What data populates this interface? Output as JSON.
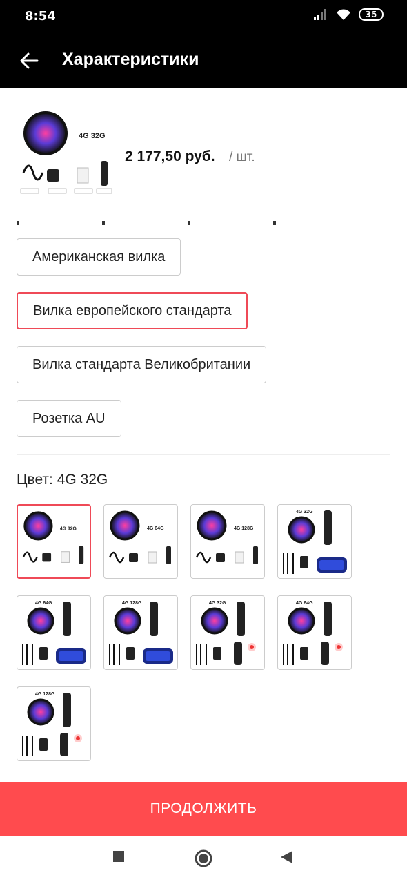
{
  "status": {
    "time": "8:54",
    "battery": "35"
  },
  "header": {
    "title": "Характеристики"
  },
  "product": {
    "price": "2 177,50 руб.",
    "unit": "/ шт.",
    "thumb_text": "4G  32G"
  },
  "plug_options": [
    {
      "label": "Американская вилка",
      "selected": false
    },
    {
      "label": "Вилка европейского стандарта",
      "selected": true
    },
    {
      "label": "Вилка стандарта Великобритании",
      "selected": false
    },
    {
      "label": "Розетка AU",
      "selected": false
    }
  ],
  "color": {
    "label": "Цвет: 4G 32G",
    "variants": [
      {
        "text": "4G  32G",
        "kind": "box",
        "selected": true
      },
      {
        "text": "4G  64G",
        "kind": "box",
        "selected": false
      },
      {
        "text": "4G  128G",
        "kind": "box",
        "selected": false
      },
      {
        "text": "4G 32G",
        "kind": "keyboard",
        "selected": false
      },
      {
        "text": "4G 64G",
        "kind": "keyboard",
        "selected": false
      },
      {
        "text": "4G 128G",
        "kind": "keyboard",
        "selected": false
      },
      {
        "text": "4G 32G",
        "kind": "airmouse",
        "selected": false
      },
      {
        "text": "4G 64G",
        "kind": "airmouse",
        "selected": false
      },
      {
        "text": "4G 128G",
        "kind": "airmouse",
        "selected": false
      }
    ]
  },
  "continue_button": {
    "label": "ПРОДОЛЖИТЬ"
  },
  "colors": {
    "accent": "#ef4a57",
    "cta": "#ff4b4e",
    "header_bg": "#000000"
  }
}
